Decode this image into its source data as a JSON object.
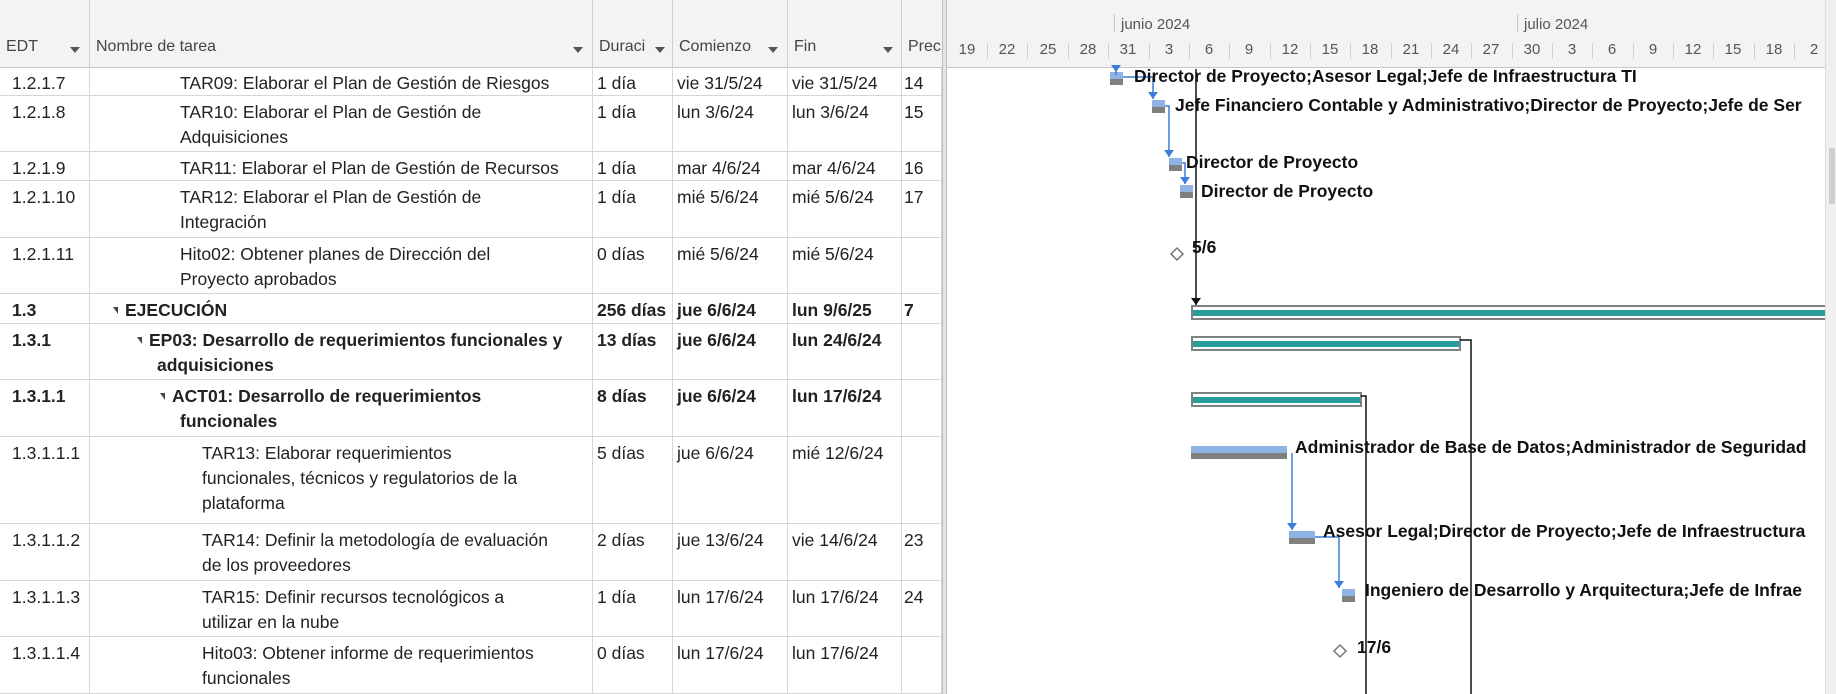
{
  "columns": {
    "edt": "EDT",
    "nombre": "Nombre de tarea",
    "duracion": "Duraci",
    "comienzo": "Comienzo",
    "fin": "Fin",
    "pred": "Prec"
  },
  "rows": [
    {
      "edt": "1.2.1.7",
      "name": [
        "TAR09: Elaborar el Plan de Gestión de Riesgos"
      ],
      "dur": "1 día",
      "start": "vie 31/5/24",
      "end": "vie 31/5/24",
      "pred": "14"
    },
    {
      "edt": "1.2.1.8",
      "name": [
        "TAR10: Elaborar el Plan de Gestión de",
        "Adquisiciones"
      ],
      "dur": "1 día",
      "start": "lun 3/6/24",
      "end": "lun 3/6/24",
      "pred": "15"
    },
    {
      "edt": "1.2.1.9",
      "name": [
        "TAR11: Elaborar el Plan de Gestión de Recursos"
      ],
      "dur": "1 día",
      "start": "mar 4/6/24",
      "end": "mar 4/6/24",
      "pred": "16"
    },
    {
      "edt": "1.2.1.10",
      "name": [
        "TAR12: Elaborar el Plan de Gestión de",
        "Integración"
      ],
      "dur": "1 día",
      "start": "mié 5/6/24",
      "end": "mié 5/6/24",
      "pred": "17"
    },
    {
      "edt": "1.2.1.11",
      "name": [
        "Hito02: Obtener planes de Dirección del",
        "Proyecto aprobados"
      ],
      "dur": "0 días",
      "start": "mié 5/6/24",
      "end": "mié 5/6/24",
      "pred": ""
    },
    {
      "edt": "1.3",
      "name": [
        "EJECUCIÓN"
      ],
      "dur": "256 días",
      "start": "jue 6/6/24",
      "end": "lun 9/6/25",
      "pred": "7"
    },
    {
      "edt": "1.3.1",
      "name": [
        "EP03: Desarrollo de requerimientos funcionales y",
        "adquisiciones"
      ],
      "dur": "13 días",
      "start": "jue 6/6/24",
      "end": "lun 24/6/24",
      "pred": ""
    },
    {
      "edt": "1.3.1.1",
      "name": [
        "ACT01: Desarrollo de requerimientos",
        "funcionales"
      ],
      "dur": "8 días",
      "start": "jue 6/6/24",
      "end": "lun 17/6/24",
      "pred": ""
    },
    {
      "edt": "1.3.1.1.1",
      "name": [
        "TAR13: Elaborar requerimientos",
        "funcionales, técnicos y regulatorios de la",
        "plataforma"
      ],
      "dur": "5 días",
      "start": "jue 6/6/24",
      "end": "mié 12/6/24",
      "pred": ""
    },
    {
      "edt": "1.3.1.1.2",
      "name": [
        "TAR14: Definir la metodología de evaluación",
        "de los proveedores"
      ],
      "dur": "2 días",
      "start": "jue 13/6/24",
      "end": "vie 14/6/24",
      "pred": "23"
    },
    {
      "edt": "1.3.1.1.3",
      "name": [
        "TAR15: Definir recursos tecnológicos a",
        "utilizar en la nube"
      ],
      "dur": "1 día",
      "start": "lun 17/6/24",
      "end": "lun 17/6/24",
      "pred": "24"
    },
    {
      "edt": "1.3.1.1.4",
      "name": [
        "Hito03: Obtener informe de requerimientos",
        "funcionales"
      ],
      "dur": "0 días",
      "start": "lun 17/6/24",
      "end": "lun 17/6/24",
      "pred": ""
    }
  ],
  "timescale": {
    "months": [
      "junio 2024",
      "julio 2024"
    ],
    "days": [
      "19",
      "22",
      "25",
      "28",
      "31",
      "3",
      "6",
      "9",
      "12",
      "15",
      "18",
      "21",
      "24",
      "27",
      "30",
      "3",
      "6",
      "9",
      "12",
      "15",
      "18",
      "2"
    ]
  },
  "gantt_labels": [
    "Director de Proyecto;Asesor Legal;Jefe de Infraestructura TI",
    "Jefe Financiero Contable y Administrativo;Director de Proyecto;Jefe de Ser",
    "Director de Proyecto",
    "Director de Proyecto",
    "5/6",
    "Administrador de Base de Datos;Administrador de Seguridad",
    "Asesor Legal;Director de Proyecto;Jefe de Infraestructura",
    "Ingeniero de Desarrollo y Arquitectura;Jefe de Infrae",
    "17/6"
  ],
  "colors": {
    "task_bar": "#8fb4e3",
    "summary_bar": "#2a9d9a",
    "baseline": "#808080",
    "link": "#3b7dd8"
  }
}
